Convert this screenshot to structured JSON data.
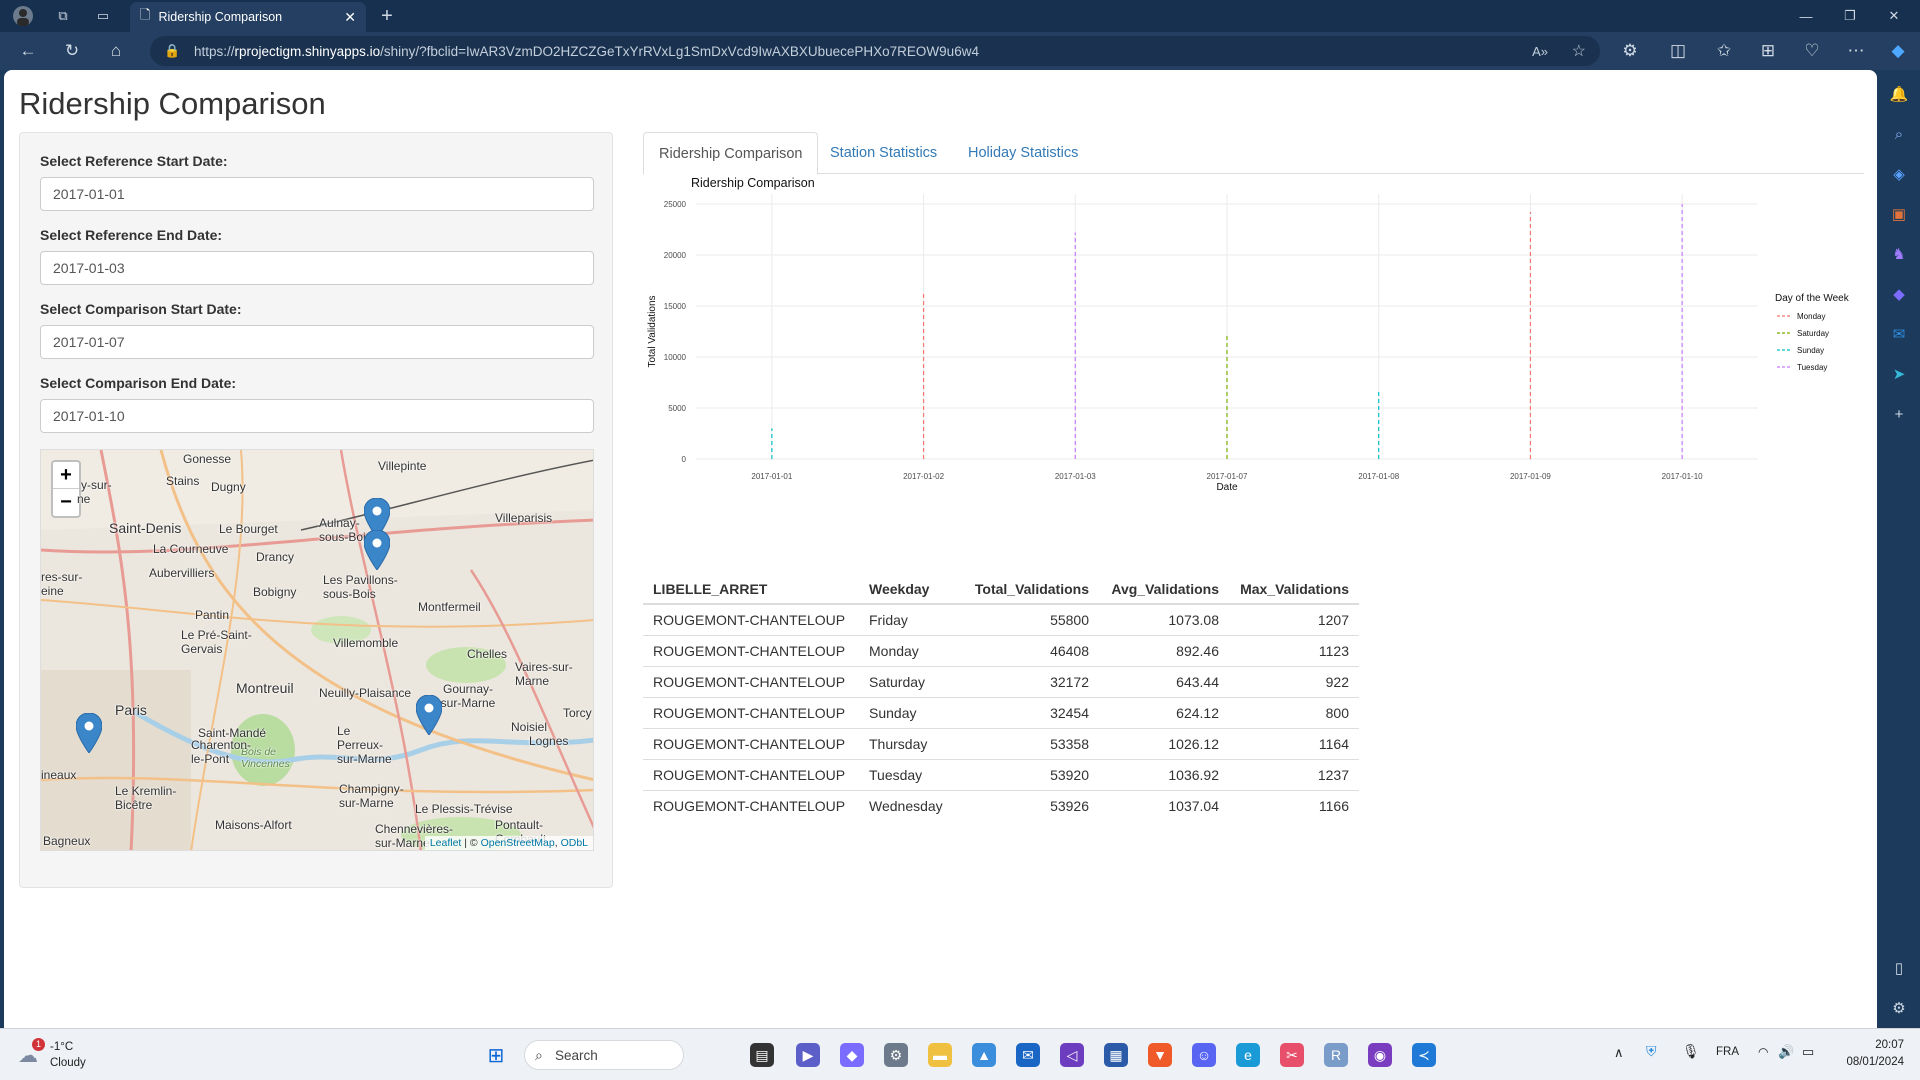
{
  "browser": {
    "tab_title": "Ridership Comparison",
    "url_prefix": "https://",
    "url_domain": "rprojectigm.shinyapps.io",
    "url_rest": "/shiny/?fbclid=IwAR3VzmDO2HZCZGeTxYrRVxLg1SmDxVcd9IwAXBXUbuecePHXo7REOW9u6w4"
  },
  "page": {
    "title": "Ridership Comparison",
    "fields": [
      {
        "label": "Select Reference Start Date:",
        "value": "2017-01-01"
      },
      {
        "label": "Select Reference End Date:",
        "value": "2017-01-03"
      },
      {
        "label": "Select Comparison Start Date:",
        "value": "2017-01-07"
      },
      {
        "label": "Select Comparison End Date:",
        "value": "2017-01-10"
      }
    ],
    "map": {
      "zoom_in": "+",
      "zoom_out": "−",
      "places": [
        "Gonesse",
        "Villepinte",
        "Stains",
        "Dugny",
        "Saint-Denis",
        "Le Bourget",
        "Aulnay-sous-Bois",
        "Villeparisis",
        "La Courneuve",
        "Drancy",
        "Aubervilliers",
        "Bobigny",
        "Les Pavillons-sous-Bois",
        "Montfermeil",
        "Pantin",
        "Le Pré-Saint-Gervais",
        "Villemomble",
        "Chelles",
        "Vaires-sur-Marne",
        "Montreuil",
        "Neuilly-Plaisance",
        "Gournay-sur-Marne",
        "Paris",
        "Saint-Mandé",
        "Le Perreux-sur-Marne",
        "Noisiel",
        "Torcy",
        "Lognes",
        "Bois de Vincennes",
        "Charenton-le-Pont",
        "Champigny-sur-Marne",
        "Le Kremlin-Bicêtre",
        "Le Plessis-Trévise",
        "Maisons-Alfort",
        "Pontault-Combault",
        "Chennevières-sur-Marne",
        "Bagneux",
        "y-sur-",
        "ne",
        "res-sur-",
        "eine",
        "ineaux"
      ],
      "attribution_leaflet": "Leaflet",
      "attribution_sep": " | © ",
      "attribution_osm": "OpenStreetMap",
      "attribution_odbl": "ODbL"
    },
    "tabs": [
      "Ridership Comparison",
      "Station Statistics",
      "Holiday Statistics"
    ]
  },
  "chart_data": {
    "type": "line",
    "title": "Ridership Comparison",
    "xlabel": "Date",
    "ylabel": "Total Validations",
    "categories": [
      "2017-01-01",
      "2017-01-02",
      "2017-01-03",
      "2017-01-07",
      "2017-01-08",
      "2017-01-09",
      "2017-01-10"
    ],
    "yticks": [
      0,
      5000,
      10000,
      15000,
      20000,
      25000
    ],
    "ylim": [
      0,
      25000
    ],
    "legend_title": "Day of the Week",
    "legend_position": "right",
    "grid": true,
    "series": [
      {
        "name": "Monday",
        "color": "#f8766d",
        "points": [
          {
            "x": "2017-01-02",
            "y": 16200
          },
          {
            "x": "2017-01-09",
            "y": 24200
          }
        ]
      },
      {
        "name": "Saturday",
        "color": "#7cae00",
        "points": [
          {
            "x": "2017-01-07",
            "y": 12100
          }
        ]
      },
      {
        "name": "Sunday",
        "color": "#00bfc4",
        "points": [
          {
            "x": "2017-01-01",
            "y": 3000
          },
          {
            "x": "2017-01-08",
            "y": 6700
          }
        ]
      },
      {
        "name": "Tuesday",
        "color": "#c77cff",
        "points": [
          {
            "x": "2017-01-03",
            "y": 22200
          },
          {
            "x": "2017-01-10",
            "y": 25000
          }
        ]
      }
    ]
  },
  "table": {
    "columns": [
      "LIBELLE_ARRET",
      "Weekday",
      "Total_Validations",
      "Avg_Validations",
      "Max_Validations"
    ],
    "rows": [
      [
        "ROUGEMONT-CHANTELOUP",
        "Friday",
        "55800",
        "1073.08",
        "1207"
      ],
      [
        "ROUGEMONT-CHANTELOUP",
        "Monday",
        "46408",
        "892.46",
        "1123"
      ],
      [
        "ROUGEMONT-CHANTELOUP",
        "Saturday",
        "32172",
        "643.44",
        "922"
      ],
      [
        "ROUGEMONT-CHANTELOUP",
        "Sunday",
        "32454",
        "624.12",
        "800"
      ],
      [
        "ROUGEMONT-CHANTELOUP",
        "Thursday",
        "53358",
        "1026.12",
        "1164"
      ],
      [
        "ROUGEMONT-CHANTELOUP",
        "Tuesday",
        "53920",
        "1036.92",
        "1237"
      ],
      [
        "ROUGEMONT-CHANTELOUP",
        "Wednesday",
        "53926",
        "1037.04",
        "1166"
      ]
    ]
  },
  "taskbar": {
    "weather_temp": "-1°C",
    "weather_desc": "Cloudy",
    "weather_badge": "1",
    "search_label": "Search",
    "lang": "FRA",
    "time": "20:07",
    "date": "08/01/2024"
  }
}
